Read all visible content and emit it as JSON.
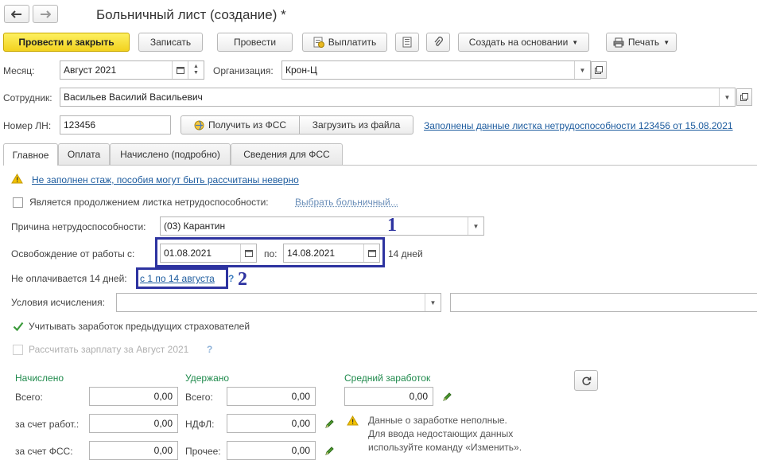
{
  "window": {
    "title": "Больничный лист (создание) *"
  },
  "nav": {
    "back_icon": "arrow-left-icon",
    "forward_icon": "arrow-right-icon"
  },
  "toolbar": {
    "post_close": "Провести и закрыть",
    "save": "Записать",
    "post": "Провести",
    "pay": "Выплатить",
    "create_based": "Создать на основании",
    "print": "Печать"
  },
  "header": {
    "month_label": "Месяц:",
    "month_value": "Август 2021",
    "org_label": "Организация:",
    "org_value": "Крон-Ц",
    "employee_label": "Сотрудник:",
    "employee_value": "Васильев Василий Васильевич",
    "ln_label": "Номер ЛН:",
    "ln_value": "123456",
    "get_fss": "Получить из ФСС",
    "load_file": "Загрузить из файла",
    "filled_link": "Заполнены данные листка нетрудоспособности 123456 от 15.08.2021"
  },
  "tabs": [
    {
      "label": "Главное"
    },
    {
      "label": "Оплата"
    },
    {
      "label": "Начислено (подробно)"
    },
    {
      "label": "Сведения для ФСС"
    }
  ],
  "main": {
    "warning_link": "Не заполнен стаж, пособия могут быть рассчитаны неверно",
    "continuation_label": "Является продолжением листка нетрудоспособности:",
    "choose_sick": "Выбрать больничный...",
    "reason_label": "Причина нетрудоспособности:",
    "reason_value": "(03) Карантин",
    "release_label": "Освобождение от работы с:",
    "date_from": "01.08.2021",
    "to_label": "по:",
    "date_to": "14.08.2021",
    "days": "14 дней",
    "unpaid_label": "Не оплачивается 14 дней:",
    "unpaid_link": "с 1 по 14 августа",
    "question": "?",
    "conditions_label": "Условия исчисления:",
    "conditions_value": "",
    "consider_prev": "Учитывать заработок предыдущих страхователей",
    "calc_salary": "Рассчитать зарплату за Август 2021",
    "calc_question": "?"
  },
  "annotations": {
    "marker1": "1",
    "marker2": "2"
  },
  "totals": {
    "accrued_title": "Начислено",
    "withheld_title": "Удержано",
    "avg_title": "Средний заработок",
    "total_label": "Всего:",
    "employer_label": "за счет работ.:",
    "fss_label": "за счет ФСС:",
    "withheld_total_label": "Всего:",
    "ndfl_label": "НДФЛ:",
    "other_label": "Прочее:",
    "accrued_total": "0,00",
    "accrued_employer": "0,00",
    "accrued_fss": "0,00",
    "withheld_total": "0,00",
    "withheld_ndfl": "0,00",
    "withheld_other": "0,00",
    "avg_value": "0,00",
    "note_line1": "Данные о заработке неполные.",
    "note_line2": "Для ввода недостающих данных",
    "note_line3": "используйте команду «Изменить»."
  },
  "colors": {
    "primary": "#f2d21f",
    "link": "#1c5b9e",
    "green": "#1f8a4c",
    "annotation": "#2d33a0"
  }
}
